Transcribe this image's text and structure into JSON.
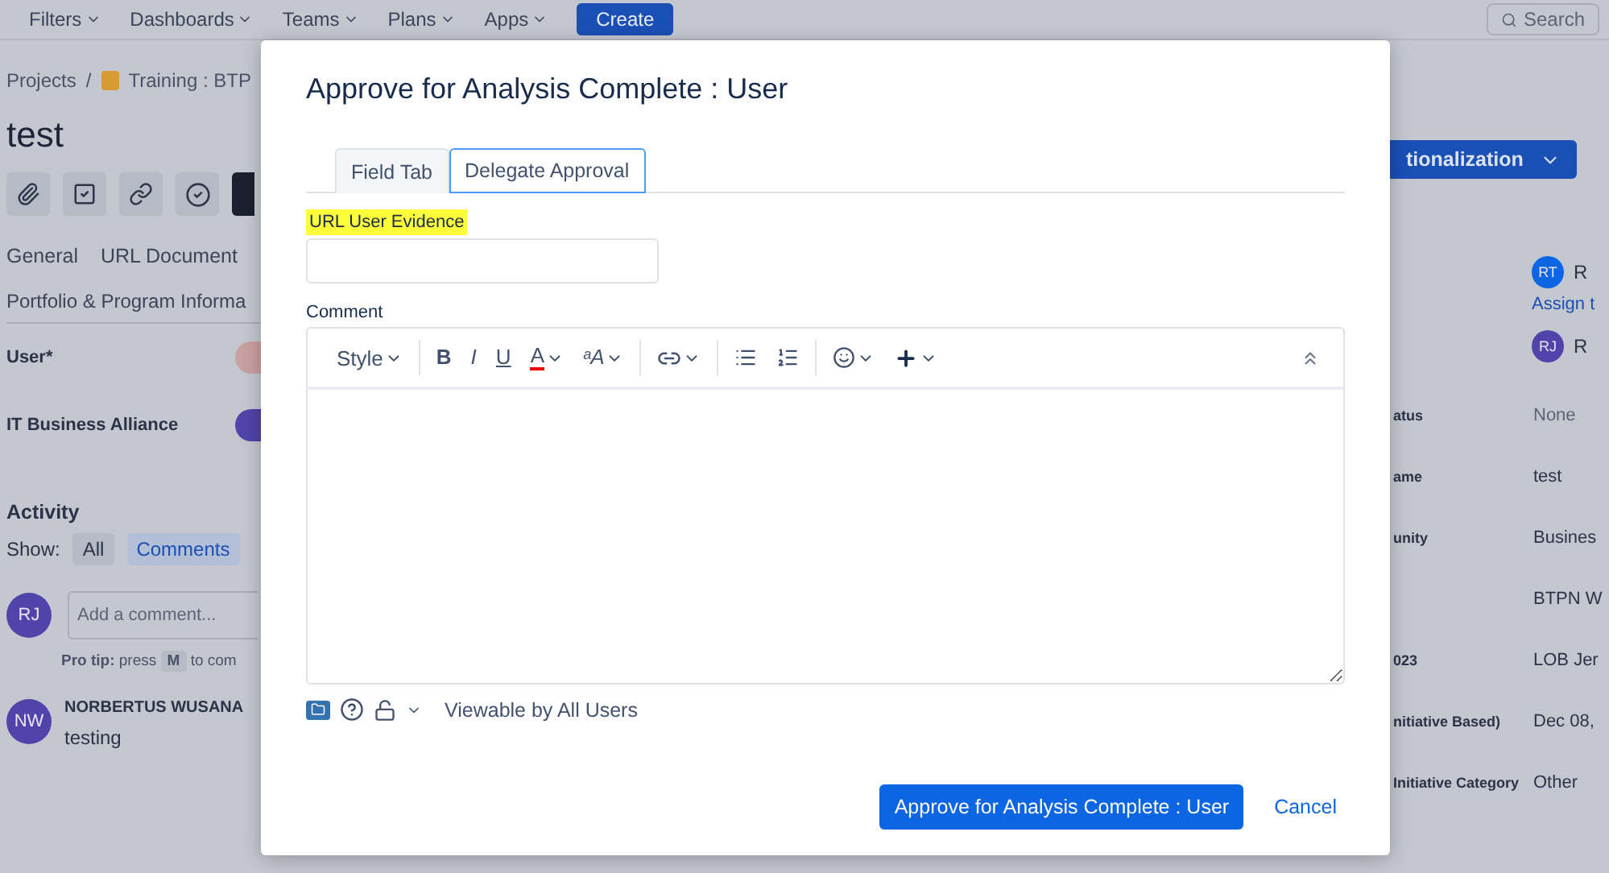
{
  "top_nav": {
    "items": [
      "Filters",
      "Dashboards",
      "Teams",
      "Plans",
      "Apps"
    ],
    "create": "Create",
    "search": {
      "placeholder": "Search"
    }
  },
  "issue": {
    "breadcrumb": {
      "root": "Projects",
      "separator": "/",
      "project": "Training : BTP"
    },
    "title": "test",
    "tabs": [
      "General",
      "URL Document"
    ],
    "tab_row_2": "Portfolio & Program Informa",
    "fields": [
      {
        "label": "User*"
      },
      {
        "label": "IT Business Alliance"
      }
    ],
    "activity": {
      "title": "Activity",
      "show_label": "Show:",
      "filters": [
        {
          "label": "All",
          "selected": false
        },
        {
          "label": "Comments",
          "selected": true
        }
      ],
      "composer": {
        "avatar": "RJ",
        "placeholder": "Add a comment..."
      },
      "pro_tip": {
        "lead": "Pro tip:",
        "text": "press",
        "key": "M",
        "rest": "to com"
      },
      "comments": [
        {
          "avatar": "NW",
          "author": "NORBERTUS WUSANA",
          "body": "testing"
        }
      ]
    }
  },
  "side": {
    "status_button": "tionalization",
    "people": [
      {
        "avatar": "RT",
        "color": "#0c66e4",
        "name": "R",
        "link": "Assign t"
      },
      {
        "avatar": "RJ",
        "color": "#5243aa",
        "name": "R"
      }
    ],
    "details": [
      {
        "label": "atus",
        "value": "None",
        "muted": true
      },
      {
        "label": "ame",
        "value": "test",
        "muted": false
      },
      {
        "label": "unity",
        "value": "Busines",
        "muted": false
      },
      {
        "value": "BTPN W",
        "muted": false
      },
      {
        "label": "023",
        "value": "LOB Jer",
        "muted": false
      },
      {
        "label": "nitiative Based)",
        "value": "Dec 08,",
        "muted": false
      },
      {
        "label": "Initiative Category",
        "value": "Other",
        "muted": false
      }
    ]
  },
  "dialog": {
    "title": "Approve for Analysis Complete : User",
    "tabs": [
      {
        "label": "Field Tab",
        "selected": false
      },
      {
        "label": "Delegate Approval",
        "selected": true
      }
    ],
    "field": {
      "label": "URL User Evidence",
      "highlighted": true
    },
    "comment_label": "Comment",
    "toolbar": [
      [
        {
          "kind": "style",
          "label": "Style"
        }
      ],
      [
        {
          "kind": "bold",
          "label": "B"
        },
        {
          "kind": "italic",
          "label": "I"
        },
        {
          "kind": "underline",
          "label": "U"
        },
        {
          "kind": "color",
          "label": "A"
        },
        {
          "kind": "size",
          "label": "ᵃA"
        }
      ],
      [
        {
          "kind": "link"
        }
      ],
      [
        {
          "kind": "bullets"
        },
        {
          "kind": "numbers"
        }
      ],
      [
        {
          "kind": "emoji"
        },
        {
          "kind": "insert"
        }
      ]
    ],
    "visibility": "Viewable by All Users",
    "submit": "Approve for Analysis Complete : User",
    "cancel": "Cancel"
  }
}
